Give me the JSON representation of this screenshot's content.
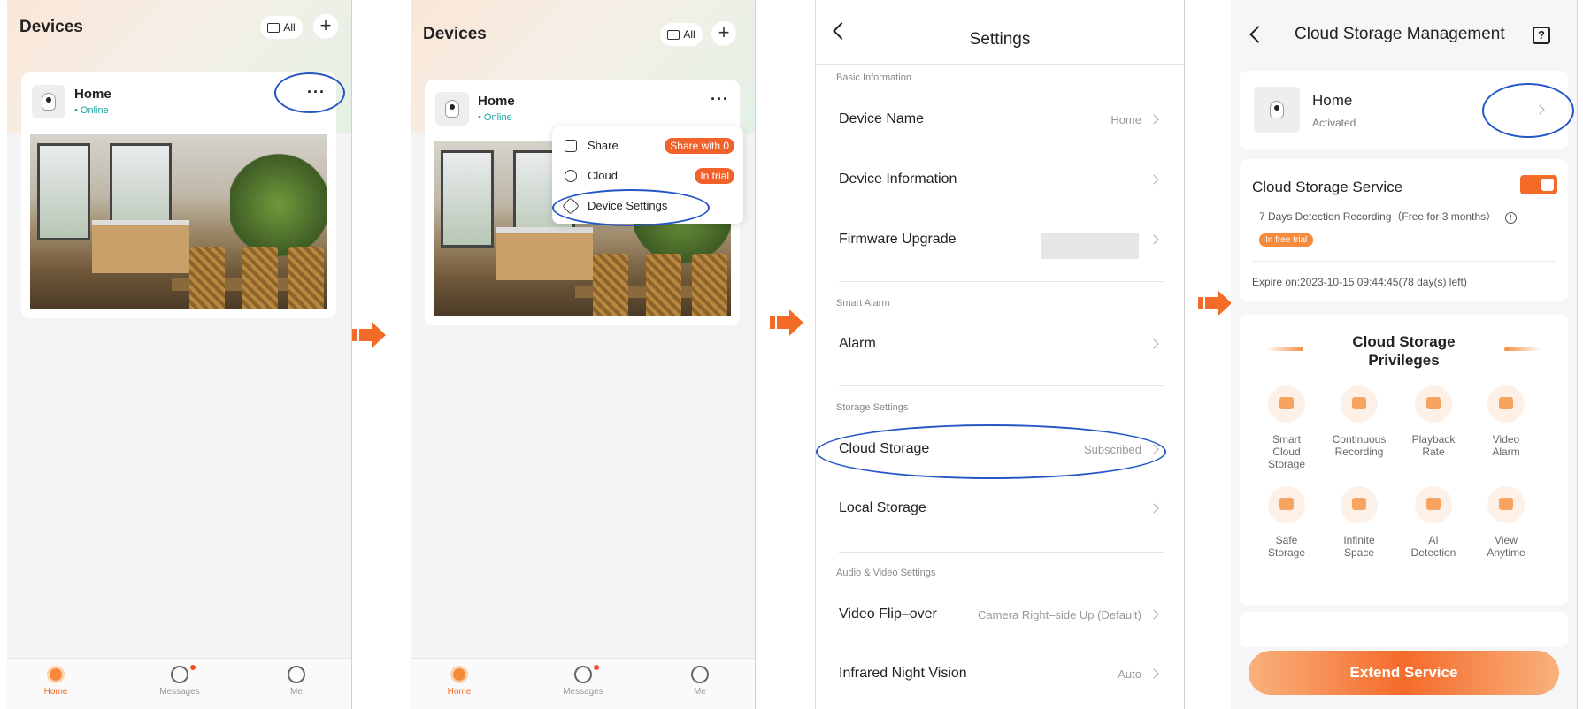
{
  "screen1": {
    "title": "Devices",
    "all_label": "All",
    "plus": "+",
    "card": {
      "name": "Home",
      "status": "Online",
      "more": "···"
    },
    "tabs": [
      "Home",
      "Messages",
      "Me"
    ]
  },
  "screen2": {
    "title": "Devices",
    "all_label": "All",
    "plus": "+",
    "card": {
      "name": "Home",
      "status": "Online",
      "more": "···"
    },
    "popup": {
      "share_label": "Share",
      "share_badge": "Share with 0",
      "cloud_label": "Cloud",
      "cloud_badge": "In trial",
      "settings_label": "Device Settings"
    },
    "tabs": [
      "Home",
      "Messages",
      "Me"
    ]
  },
  "screen3": {
    "title": "Settings",
    "sections": {
      "basic": "Basic Information",
      "alarm": "Smart Alarm",
      "storage": "Storage Settings",
      "av": "Audio & Video Settings"
    },
    "rows": {
      "device_name": "Device Name",
      "device_name_val": "Home",
      "device_info": "Device Information",
      "firmware": "Firmware Upgrade",
      "alarm": "Alarm",
      "cloud": "Cloud Storage",
      "cloud_val": "Subscribed",
      "local": "Local Storage",
      "flip": "Video Flip–over",
      "flip_val": "Camera Right–side Up (Default)",
      "ir": "Infrared Night Vision",
      "ir_val": "Auto"
    }
  },
  "screen4": {
    "title": "Cloud Storage Management",
    "help": "?",
    "device": {
      "name": "Home",
      "status": "Activated"
    },
    "service": {
      "title": "Cloud Storage Service",
      "desc": "7 Days Detection Recording（Free for 3 months）",
      "badge": "In free trial",
      "expire": "Expire on:2023-10-15 09:44:45(78 day(s) left)"
    },
    "privileges_title_1": "Cloud Storage",
    "privileges_title_2": "Privileges",
    "privileges": [
      {
        "l1": "Smart",
        "l2": "Cloud",
        "l3": "Storage",
        "icon": "cloud-icon"
      },
      {
        "l1": "Continuous",
        "l2": "Recording",
        "l3": "",
        "icon": "video-icon"
      },
      {
        "l1": "Playback",
        "l2": "Rate",
        "l3": "",
        "icon": "speed-icon"
      },
      {
        "l1": "Video",
        "l2": "Alarm",
        "l3": "",
        "icon": "play-icon"
      },
      {
        "l1": "Safe",
        "l2": "Storage",
        "l3": "",
        "icon": "shield-icon"
      },
      {
        "l1": "Infinite",
        "l2": "Space",
        "l3": "",
        "icon": "box-icon"
      },
      {
        "l1": "AI",
        "l2": "Detection",
        "l3": "",
        "icon": "scan-icon"
      },
      {
        "l1": "View",
        "l2": "Anytime",
        "l3": "",
        "icon": "camera-icon"
      }
    ],
    "extend": "Extend Service"
  },
  "colors": {
    "accent": "#f36b27",
    "highlight": "#2457c5",
    "online": "#18a7a0"
  }
}
